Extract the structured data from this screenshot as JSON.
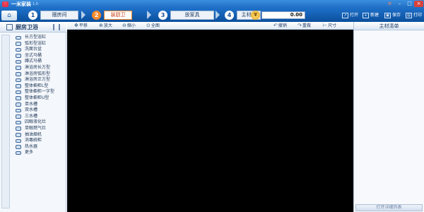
{
  "window": {
    "logo_glyph": "♡",
    "title": "一米家装",
    "version": "1.0",
    "badge_icon": "≡",
    "minimize_glyph": "–",
    "maximize_glyph": "□",
    "close_glyph": "×"
  },
  "stepbar": {
    "home_glyph": "⌂",
    "steps": [
      {
        "num": "1",
        "label": "摆房间",
        "active": false
      },
      {
        "num": "2",
        "label": "装厨卫",
        "active": true
      },
      {
        "num": "3",
        "label": "放家具",
        "active": false
      },
      {
        "num": "4",
        "label": "主材价",
        "active": false
      }
    ],
    "coin_glyph": "¥",
    "price": "0.00",
    "actions": [
      {
        "icon": "open-icon",
        "glyph": "↗",
        "label": "打开"
      },
      {
        "icon": "new-icon",
        "glyph": "+",
        "label": "新建"
      },
      {
        "icon": "save-icon",
        "glyph": "▣",
        "label": "保存"
      },
      {
        "icon": "print-icon",
        "glyph": "▤",
        "label": "打印"
      }
    ]
  },
  "sidebar": {
    "title": "厨房卫浴",
    "items": [
      "长方型浴缸",
      "弧形型浴缸",
      "洗面台盆",
      "坐式马桶",
      "蹲式马桶",
      "淋浴房长方型",
      "淋浴房弧形型",
      "淋浴房正方型",
      "整体橱柜L型",
      "整体橱柜一字型",
      "整体橱柜U型",
      "单水槽",
      "双水槽",
      "三水槽",
      "四眼液化灶",
      "单眼燃气灶",
      "抽油烟机",
      "消毒碗柜",
      "热水器",
      "更多"
    ]
  },
  "canvas_toolbar": {
    "pan": "平移",
    "zoom_in": "放大",
    "zoom_out": "缩小",
    "fit_all": "全图",
    "undo": "撤销",
    "redo": "重做",
    "dimension": "尺寸"
  },
  "right_panel": {
    "title": "主材清单",
    "footer_button": "打开详细列表"
  },
  "colors": {
    "titlebar": "#1c6cc2",
    "active_step": "#f4892d",
    "canvas": "#000000"
  }
}
